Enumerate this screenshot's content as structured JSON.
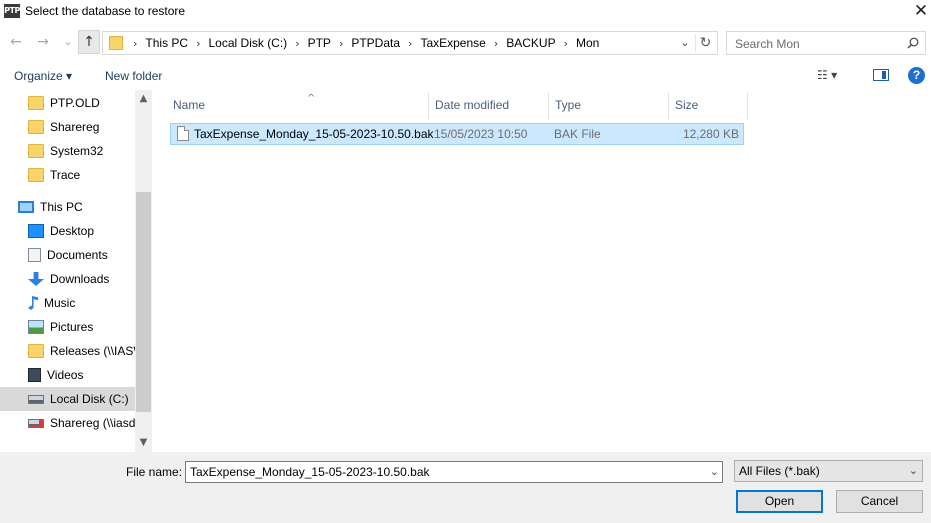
{
  "window": {
    "app_icon_text": "PTP",
    "title": "Select the database to restore",
    "close_glyph": "✕"
  },
  "navigation": {
    "back_glyph": "←",
    "forward_glyph": "→",
    "recent_glyph": "⌄",
    "up_glyph": "↑",
    "breadcrumbs": [
      "This PC",
      "Local Disk (C:)",
      "PTP",
      "PTPData",
      "TaxExpense",
      "BACKUP",
      "Mon"
    ],
    "separator": "›",
    "dropdown_glyph": "⌄",
    "refresh_glyph": "↻",
    "search_placeholder": "Search Mon"
  },
  "toolbar": {
    "organize_label": "Organize ▾",
    "new_folder_label": "New folder",
    "view_label": "☷ ▾",
    "help_label": "?"
  },
  "sidebar": {
    "items": [
      {
        "label": "PTP.OLD",
        "icon": "folder-icon"
      },
      {
        "label": "Sharereg",
        "icon": "folder-icon"
      },
      {
        "label": "System32",
        "icon": "folder-icon"
      },
      {
        "label": "Trace",
        "icon": "folder-icon"
      },
      {
        "label": "This PC",
        "icon": "computer-icon"
      },
      {
        "label": "Desktop",
        "icon": "desktop-icon"
      },
      {
        "label": "Documents",
        "icon": "documents-icon"
      },
      {
        "label": "Downloads",
        "icon": "download-icon"
      },
      {
        "label": "Music",
        "icon": "music-icon"
      },
      {
        "label": "Pictures",
        "icon": "pictures-icon"
      },
      {
        "label": "Releases (\\\\IASWC",
        "icon": "network-folder-icon"
      },
      {
        "label": "Videos",
        "icon": "videos-icon"
      },
      {
        "label": "Local Disk (C:)",
        "icon": "drive-icon"
      },
      {
        "label": "Sharereg (\\\\iasdc",
        "icon": "network-drive-icon"
      }
    ],
    "selected": "Local Disk (C:)",
    "scroll_up_glyph": "▲",
    "scroll_down_glyph": "▼"
  },
  "filelist": {
    "sort_indicator": "^",
    "columns": [
      "Name",
      "Date modified",
      "Type",
      "Size"
    ],
    "rows": [
      {
        "name": "TaxExpense_Monday_15-05-2023-10.50.bak",
        "date": "15/05/2023 10:50",
        "type": "BAK File",
        "size": "12,280 KB"
      }
    ]
  },
  "footer": {
    "filename_label": "File name:",
    "filename_value": "TaxExpense_Monday_15-05-2023-10.50.bak",
    "filter_value": "All Files (*.bak)",
    "dropdown_glyph": "⌄",
    "open_label": "Open",
    "cancel_label": "Cancel"
  },
  "colors": {
    "selection_bg": "#cce8ff",
    "selection_border": "#99d1ff",
    "accent": "#0078d7",
    "folder": "#f9d46b"
  }
}
